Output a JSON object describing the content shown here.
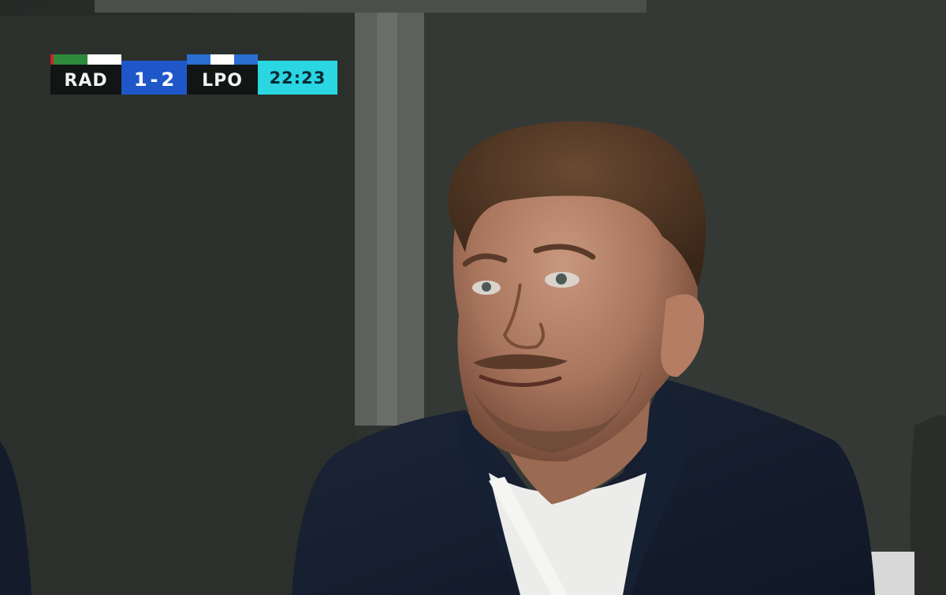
{
  "scoreboard": {
    "home_team": "RAD",
    "away_team": "LPO",
    "home_score": "1",
    "separator": "-",
    "away_score": "2",
    "clock": "22:23"
  },
  "colors": {
    "score_panel": "#1f57c9",
    "clock_panel": "#29d6e2",
    "home_kit_1": "#2e8b3c",
    "home_kit_2": "#ffffff",
    "away_kit_1": "#2a6fd1",
    "away_kit_2": "#ffffff"
  }
}
